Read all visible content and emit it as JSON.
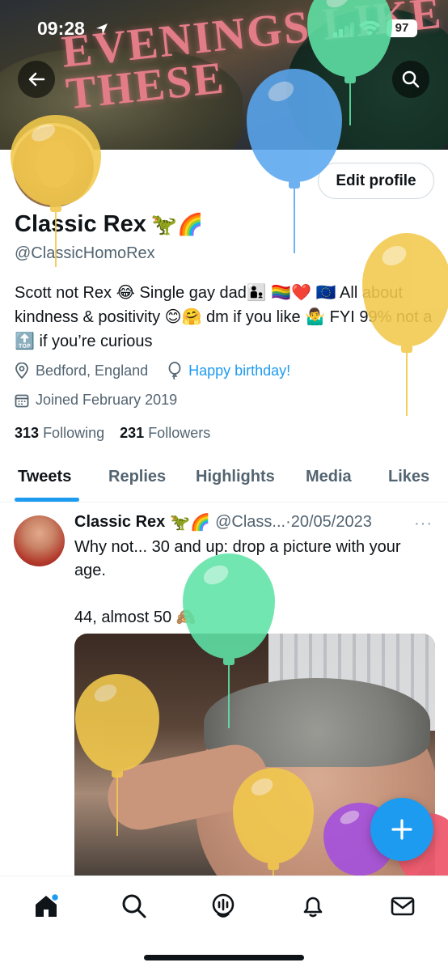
{
  "status_bar": {
    "time": "09:28",
    "battery": "97"
  },
  "banner": {
    "text": "EVENINGS LIKE THESE"
  },
  "profile": {
    "name": "Classic Rex",
    "name_emoji": "🦖🌈",
    "handle": "@ClassicHomoRex",
    "edit_label": "Edit profile",
    "bio": "Scott not Rex 😂 Single gay dad👨‍👦 🏳️‍🌈❤️ 🇪🇺 All about kindness & positivity 😊🤗 dm if you like 🤷‍♂️ FYI 99% not a 🔝 if you’re curious",
    "location": "Bedford, England",
    "birthday": "Happy birthday!",
    "joined": "Joined February 2019",
    "following_count": "313",
    "following_label": "Following",
    "followers_count": "231",
    "followers_label": "Followers"
  },
  "tabs": [
    {
      "label": "Tweets",
      "active": true
    },
    {
      "label": "Replies"
    },
    {
      "label": "Highlights"
    },
    {
      "label": "Media"
    },
    {
      "label": "Likes"
    }
  ],
  "tweet": {
    "name": "Classic Rex",
    "name_emoji": "🦖🌈",
    "handle": "@Class...",
    "date": "·20/05/2023",
    "more": "···",
    "text": "Why not... 30 and up: drop a picture with your age.\n\n44, almost 50 🙈"
  },
  "balloons": [
    {
      "color": "#f2c94c"
    },
    {
      "color": "#5aa7f0"
    },
    {
      "color": "#5fe3a6"
    },
    {
      "color": "#f2c94c"
    },
    {
      "color": "#5fe3a6"
    },
    {
      "color": "#f2c94c"
    },
    {
      "color": "#f2c94c"
    },
    {
      "color": "#a44fe0"
    },
    {
      "color": "#ef5a6f"
    }
  ],
  "fab": {
    "icon": "plus-icon",
    "color": "#1d9bf0"
  },
  "bottom_nav": [
    "home-icon",
    "search-icon",
    "spaces-icon",
    "notifications-icon",
    "messages-icon"
  ],
  "colors": {
    "accent": "#1d9bf0",
    "secondary_text": "#536471"
  }
}
